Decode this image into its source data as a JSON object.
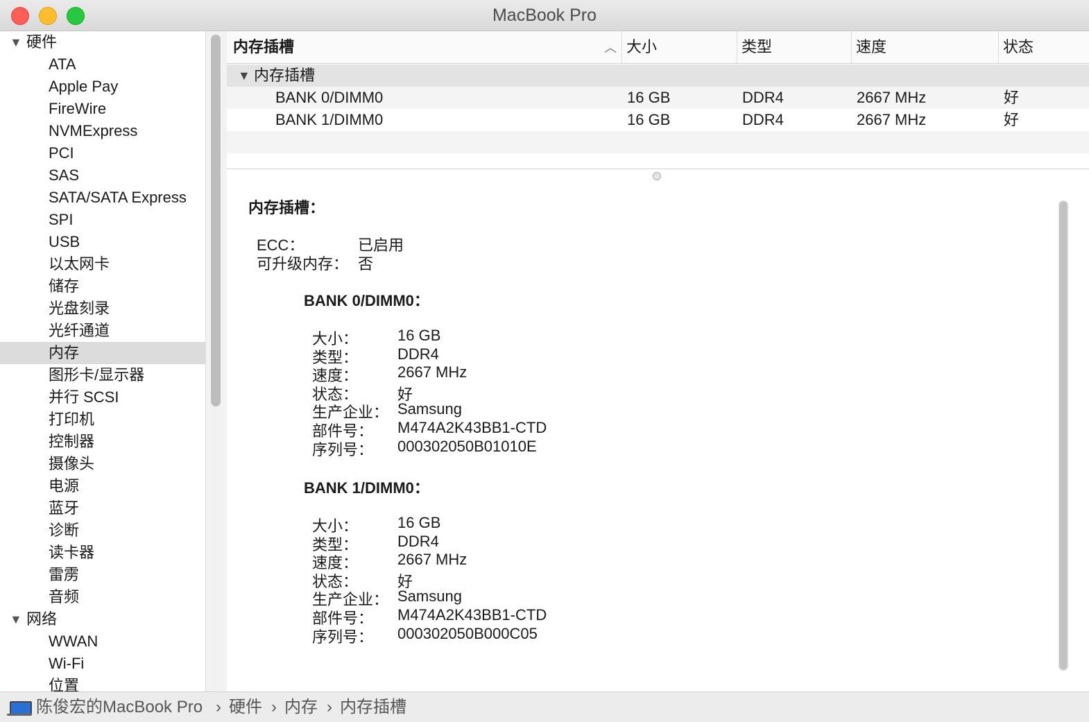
{
  "window": {
    "title": "MacBook Pro"
  },
  "sidebar": {
    "rows": [
      {
        "label": "硬件",
        "kind": "group"
      },
      {
        "label": "ATA",
        "kind": "item"
      },
      {
        "label": "Apple Pay",
        "kind": "item"
      },
      {
        "label": "FireWire",
        "kind": "item"
      },
      {
        "label": "NVMExpress",
        "kind": "item"
      },
      {
        "label": "PCI",
        "kind": "item"
      },
      {
        "label": "SAS",
        "kind": "item"
      },
      {
        "label": "SATA/SATA Express",
        "kind": "item"
      },
      {
        "label": "SPI",
        "kind": "item"
      },
      {
        "label": "USB",
        "kind": "item"
      },
      {
        "label": "以太网卡",
        "kind": "item"
      },
      {
        "label": "储存",
        "kind": "item"
      },
      {
        "label": "光盘刻录",
        "kind": "item"
      },
      {
        "label": "光纤通道",
        "kind": "item"
      },
      {
        "label": "内存",
        "kind": "item",
        "selected": true
      },
      {
        "label": "图形卡/显示器",
        "kind": "item"
      },
      {
        "label": "并行 SCSI",
        "kind": "item"
      },
      {
        "label": "打印机",
        "kind": "item"
      },
      {
        "label": "控制器",
        "kind": "item"
      },
      {
        "label": "摄像头",
        "kind": "item"
      },
      {
        "label": "电源",
        "kind": "item"
      },
      {
        "label": "蓝牙",
        "kind": "item"
      },
      {
        "label": "诊断",
        "kind": "item"
      },
      {
        "label": "读卡器",
        "kind": "item"
      },
      {
        "label": "雷雳",
        "kind": "item"
      },
      {
        "label": "音频",
        "kind": "item"
      },
      {
        "label": "网络",
        "kind": "group"
      },
      {
        "label": "WWAN",
        "kind": "item"
      },
      {
        "label": "Wi-Fi",
        "kind": "item"
      },
      {
        "label": "位置",
        "kind": "item"
      }
    ]
  },
  "table": {
    "columns": [
      "内存插槽",
      "大小",
      "类型",
      "速度",
      "状态"
    ],
    "group_label": "内存插槽",
    "rows": [
      [
        "BANK 0/DIMM0",
        "16 GB",
        "DDR4",
        "2667 MHz",
        "好"
      ],
      [
        "BANK 1/DIMM0",
        "16 GB",
        "DDR4",
        "2667 MHz",
        "好"
      ]
    ]
  },
  "detail": {
    "title": "内存插槽：",
    "general": [
      {
        "key": "ECC：",
        "value": "已启用"
      },
      {
        "key": "可升级内存：",
        "value": "否"
      }
    ],
    "banks": [
      {
        "title": "BANK 0/DIMM0：",
        "fields": [
          {
            "key": "大小：",
            "value": "16 GB"
          },
          {
            "key": "类型：",
            "value": "DDR4"
          },
          {
            "key": "速度：",
            "value": "2667 MHz"
          },
          {
            "key": "状态：",
            "value": "好"
          },
          {
            "key": "生产企业：",
            "value": "Samsung"
          },
          {
            "key": "部件号：",
            "value": "M474A2K43BB1-CTD"
          },
          {
            "key": "序列号：",
            "value": "000302050B01010E"
          }
        ]
      },
      {
        "title": "BANK 1/DIMM0：",
        "fields": [
          {
            "key": "大小：",
            "value": "16 GB"
          },
          {
            "key": "类型：",
            "value": "DDR4"
          },
          {
            "key": "速度：",
            "value": "2667 MHz"
          },
          {
            "key": "状态：",
            "value": "好"
          },
          {
            "key": "生产企业：",
            "value": "Samsung"
          },
          {
            "key": "部件号：",
            "value": "M474A2K43BB1-CTD"
          },
          {
            "key": "序列号：",
            "value": "000302050B000C05"
          }
        ]
      }
    ]
  },
  "pathbar": {
    "icon": "macbook-icon",
    "crumbs": [
      "陈俊宏的MacBook Pro",
      "硬件",
      "内存",
      "内存插槽"
    ],
    "separator": "›"
  }
}
